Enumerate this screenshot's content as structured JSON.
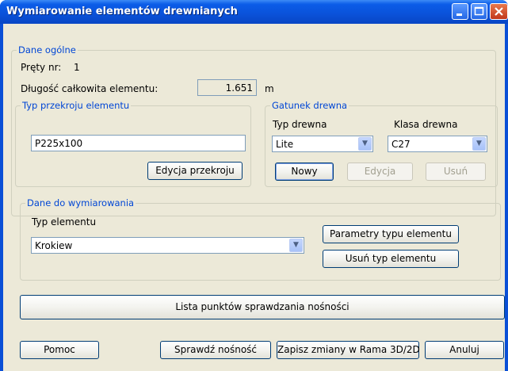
{
  "window": {
    "title": "Wymiarowanie elementów drewnianych"
  },
  "general": {
    "legend": "Dane ogólne",
    "bars_label": "Pręty nr:",
    "bars_value": "1",
    "length_label": "Długość całkowita elementu:",
    "length_value": "1.651",
    "length_unit": "m"
  },
  "section": {
    "legend": "Typ przekroju elementu",
    "value": "P225x100",
    "edit_button": "Edycja przekroju"
  },
  "wood": {
    "legend": "Gatunek drewna",
    "type_label": "Typ drewna",
    "type_value": "Lite",
    "class_label": "Klasa drewna",
    "class_value": "C27",
    "new_button": "Nowy",
    "edit_button": "Edycja",
    "delete_button": "Usuń"
  },
  "design": {
    "legend": "Dane do wymiarowania",
    "element_type_label": "Typ elementu",
    "element_type_value": "Krokiew",
    "params_button": "Parametry typu elementu",
    "delete_type_button": "Usuń typ elementu"
  },
  "list_button": "Lista punktów sprawdzania nośności",
  "footer": {
    "help": "Pomoc",
    "check": "Sprawdź nośność",
    "save": "Zapisz zmiany w Rama 3D/2D",
    "cancel": "Anuluj"
  }
}
